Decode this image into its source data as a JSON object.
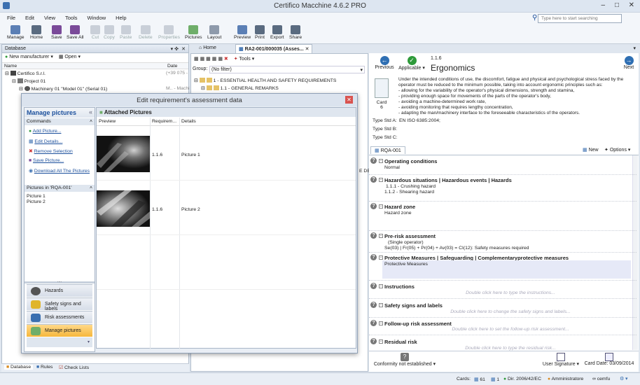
{
  "window": {
    "title": "Certifico Macchine 4.6.2 PRO"
  },
  "menu": [
    "File",
    "Edit",
    "View",
    "Tools",
    "Window",
    "Help"
  ],
  "search": {
    "placeholder": "Type here to start searching"
  },
  "toolbar": {
    "buttons": [
      "Manage",
      "Home",
      "Save",
      "Save All",
      "Cut",
      "Copy",
      "Paste",
      "Delete",
      "Properties",
      "Pictures",
      "Layout",
      "Preview",
      "Print",
      "Export",
      "Share"
    ]
  },
  "database_panel": {
    "title": "Database",
    "new_manufacturer": "New manufacturer",
    "open": "Open",
    "col_name": "Name",
    "col_date": "Date",
    "tree": [
      {
        "label": "Certifico S.r.l.",
        "date": "(+39 075 -"
      },
      {
        "label": "Project 01",
        "date": ""
      },
      {
        "label": "Machinery 01 \"Model 01\" (Serial 01)",
        "date": "M.. - Machi"
      }
    ],
    "tabs": [
      "Database",
      "Rules",
      "Check Lists"
    ]
  },
  "doc_tabs": {
    "home": "Home",
    "active": "RA2-001/000035 (Asses..."
  },
  "middle": {
    "tools": "Tools",
    "group_label": "Group:",
    "group_value": "(No filter)",
    "tree": [
      "1 - ESSENTIAL HEALTH AND SAFETY REQUIREMENTS",
      "1.1 - GENERAL REMARKS"
    ],
    "cut_text": "E DEV"
  },
  "requirement": {
    "previous": "Previous",
    "applicable": "Applicable",
    "next": "Next",
    "code": "1.1.6",
    "title": "Ergonomics",
    "card_label": "Card",
    "card_no": "6",
    "description": [
      "Under the intended conditions of use, the discomfort, fatigue and physical and psychological stress faced by the",
      "operator must be reduced to the minimum possible, taking into account ergonomic principles such as:",
      "- allowing for the variability of the operator's physical dimensions, strength and stamina,",
      "- providing enough space for movements of the parts of the operator's body,",
      "- avoiding a machine-determined work rate,",
      "- avoiding monitoring that requires lengthy concentration,",
      "- adapting the man/machinery interface to the foreseeable characteristics of the operators."
    ],
    "std_a_label": "Type Std A:",
    "std_a_value": "EN ISO 6385:2004;",
    "std_b_label": "Type Std B:",
    "std_c_label": "Type Std C:",
    "rqa_tab": "RQA-001",
    "new": "New",
    "options": "Options"
  },
  "sections": {
    "operating_conditions": {
      "title": "Operating conditions",
      "value": "Normal"
    },
    "hazardous": {
      "title": "Hazardous situations | Hazardous events | Hazards",
      "items": [
        "1.1.1 - Crushing hazard",
        "1.1.2 - Shearing hazard"
      ]
    },
    "hazard_zone": {
      "title": "Hazard zone",
      "value": "Hazard zone"
    },
    "pre_risk": {
      "title": "Pre-risk assessment",
      "line1": "(Single operator)",
      "line2": "Se(03) | Fr(05) + Pr(04) + Av(03) = CI(12): Safety measures required"
    },
    "protective": {
      "title": "Protective Measures | Safeguarding | Complementaryprotective measures",
      "value": "Protective Measures"
    },
    "instructions": {
      "title": "Instructions",
      "hint": "Double click here to type the instructions..."
    },
    "safety_signs": {
      "title": "Safety signs and labels",
      "hint": "Double click here to change the safety signs and labels..."
    },
    "followup": {
      "title": "Follow-up risk assessment",
      "hint": "Double click here to set the follow-up risk assessment..."
    },
    "residual": {
      "title": "Residual risk",
      "hint": "Double click here to type the residual risk..."
    }
  },
  "bottom_bar": {
    "conformity": "Conformity not established",
    "user_signature": "User Signature",
    "card_date": "Card Date: 03/09/2014"
  },
  "status": {
    "cards_label": "Cards:",
    "cards_count": "61",
    "count2": "1",
    "directive": "Dir. 2006/42/EC",
    "user": "Amministratore",
    "account": "cemfu"
  },
  "dialog": {
    "title": "Edit requirement's assessment data",
    "manage_pictures": "Manage pictures",
    "commands": "Commands",
    "actions": [
      "Add Picture...",
      "Edit Details...",
      "Remove Selection",
      "Save Picture...",
      "Download All The Pictures"
    ],
    "pictures_in": "Pictures in 'RQA-001'",
    "picture_list": [
      "Picture 1",
      "Picture 2"
    ],
    "attached_pictures": "Attached Pictures",
    "col_preview": "Preview",
    "col_requirement": "Requirem...",
    "col_details": "Details",
    "rows": [
      {
        "req": "1.1.6",
        "details": "Picture 1"
      },
      {
        "req": "1.1.6",
        "details": "Picture 2"
      }
    ],
    "nav": [
      "Hazards",
      "Safety signs and labels",
      "Risk assessments",
      "Manage pictures"
    ]
  }
}
